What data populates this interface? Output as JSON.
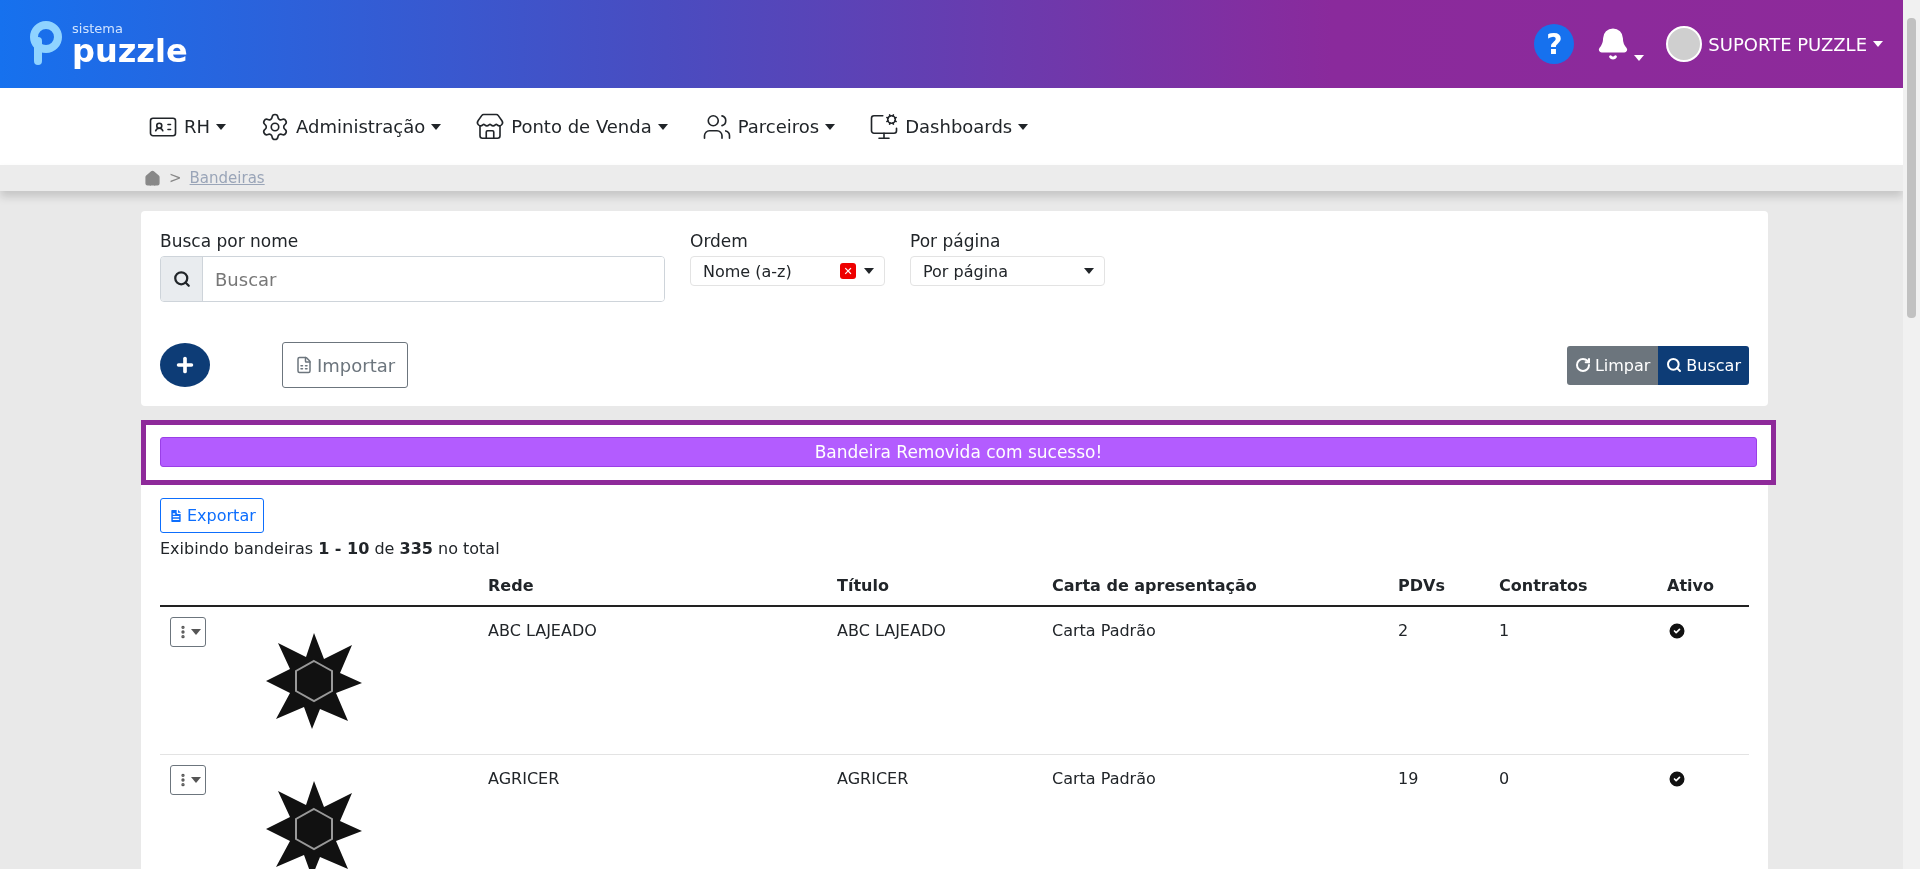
{
  "brand": {
    "small": "sistema",
    "name": "puzzle"
  },
  "help": "?",
  "user": {
    "name": "SUPORTE PUZZLE"
  },
  "nav": [
    {
      "kind": "rh",
      "label": "RH"
    },
    {
      "kind": "admin",
      "label": "Administração"
    },
    {
      "kind": "store",
      "label": "Ponto de Venda"
    },
    {
      "kind": "partners",
      "label": "Parceiros"
    },
    {
      "kind": "dashboards",
      "label": "Dashboards"
    }
  ],
  "breadcrumb": {
    "separator": ">",
    "current": "Bandeiras"
  },
  "filters": {
    "search": {
      "label": "Busca por nome",
      "placeholder": "Buscar"
    },
    "order": {
      "label": "Ordem",
      "value": "Nome (a-z)",
      "clear": "✕"
    },
    "per_page": {
      "label": "Por página",
      "placeholder": "Por página"
    },
    "import_button": "Importar",
    "clear_button": "Limpar",
    "search_button": "Buscar"
  },
  "alert": "Bandeira Removida com sucesso!",
  "export_button": "Exportar",
  "summary": "Exibindo bandeiras **1 - 10** de **335** no total",
  "table": {
    "columns": [
      "Rede",
      "Título",
      "Carta de apresentação",
      "PDVs",
      "Contratos",
      "Ativo"
    ],
    "rows": [
      {
        "rede": "ABC LAJEADO",
        "titulo": "ABC LAJEADO",
        "carta": "Carta Padrão",
        "pdvs": "2",
        "contratos": "1",
        "active": true
      },
      {
        "rede": "AGRICER",
        "titulo": "AGRICER",
        "carta": "Carta Padrão",
        "pdvs": "19",
        "contratos": "0",
        "active": true
      }
    ]
  }
}
